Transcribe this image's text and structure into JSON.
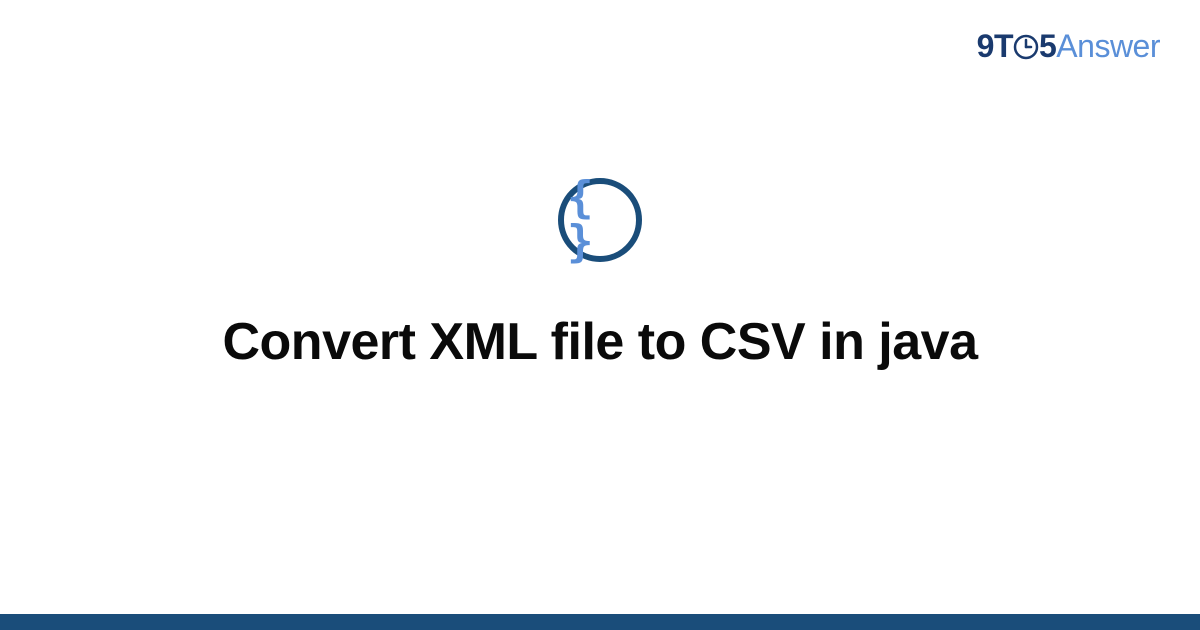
{
  "brand": {
    "part1": "9",
    "part2": "T",
    "part3": "5",
    "part4": "Answer"
  },
  "icon": {
    "glyph": "{ }",
    "name": "code-braces"
  },
  "title": "Convert XML file to CSV in java",
  "colors": {
    "dark_blue": "#1a4d7a",
    "light_blue": "#5a8fd8",
    "brand_dark": "#1a3a6e"
  }
}
